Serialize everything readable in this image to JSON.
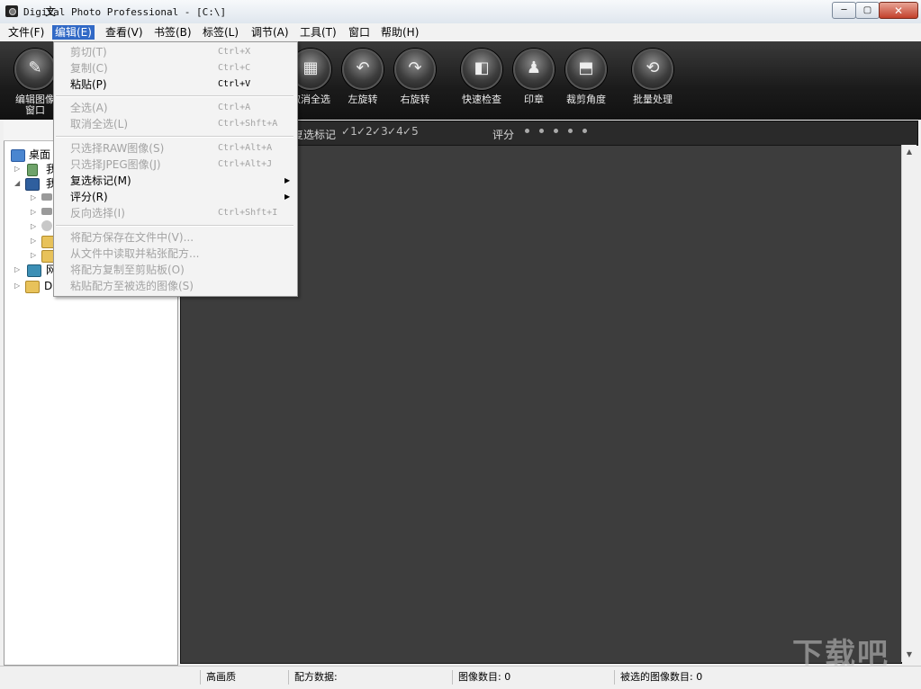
{
  "window": {
    "title": "Digital Photo Professional - [C:\\]",
    "min": "─",
    "max": "▢",
    "close": "✕"
  },
  "menubar": {
    "items": [
      "文件(F)",
      "编辑(E)",
      "查看(V)",
      "书签(B)",
      "标签(L)",
      "调节(A)",
      "工具(T)",
      "窗口",
      "帮助(H)"
    ]
  },
  "toolbar": {
    "tools": [
      {
        "label": "编辑图像窗口",
        "icon": "edit-window-icon"
      },
      {
        "label": "取消全选",
        "icon": "deselect-all-icon"
      },
      {
        "label": "左旋转",
        "icon": "rotate-left-icon"
      },
      {
        "label": "右旋转",
        "icon": "rotate-right-icon"
      },
      {
        "label": "快速检查",
        "icon": "quick-check-icon"
      },
      {
        "label": "印章",
        "icon": "stamp-icon"
      },
      {
        "label": "裁剪角度",
        "icon": "crop-angle-icon"
      },
      {
        "label": "批量处理",
        "icon": "batch-process-icon"
      }
    ]
  },
  "edit_menu": [
    {
      "label": "剪切(T)",
      "shortcut": "Ctrl+X",
      "disabled": true
    },
    {
      "label": "复制(C)",
      "shortcut": "Ctrl+C",
      "disabled": true
    },
    {
      "label": "粘贴(P)",
      "shortcut": "Ctrl+V",
      "disabled": false
    },
    {
      "label": "全选(A)",
      "shortcut": "Ctrl+A",
      "disabled": true
    },
    {
      "label": "取消全选(L)",
      "shortcut": "Ctrl+Shft+A",
      "disabled": true
    },
    {
      "label": "只选择RAW图像(S)",
      "shortcut": "Ctrl+Alt+A",
      "disabled": true
    },
    {
      "label": "只选择JPEG图像(J)",
      "shortcut": "Ctrl+Alt+J",
      "disabled": true
    },
    {
      "label": "复选标记(M)",
      "shortcut": "",
      "disabled": false,
      "submenu": true
    },
    {
      "label": "评分(R)",
      "shortcut": "",
      "disabled": false,
      "submenu": true
    },
    {
      "label": "反向选择(I)",
      "shortcut": "Ctrl+Shft+I",
      "disabled": true
    },
    {
      "label": "将配方保存在文件中(V)...",
      "shortcut": "",
      "disabled": true
    },
    {
      "label": "从文件中读取并粘张配方...",
      "shortcut": "",
      "disabled": true
    },
    {
      "label": "将配方复制至剪贴板(O)",
      "shortcut": "",
      "disabled": true
    },
    {
      "label": "粘贴配方至被选的图像(S)",
      "shortcut": "",
      "disabled": true
    }
  ],
  "left_panel": {
    "tab_label": "文",
    "tree": [
      {
        "label": "桌面",
        "icon": "desktop-icon"
      },
      {
        "label": "我",
        "icon": "documents-icon"
      },
      {
        "label": "我",
        "icon": "computer-icon"
      },
      {
        "label": "",
        "icon": "drive-icon"
      },
      {
        "label": "",
        "icon": "drive-icon"
      },
      {
        "label": "",
        "icon": "cd-drive-icon"
      },
      {
        "label": "",
        "icon": "folder-icon"
      },
      {
        "label": "",
        "icon": "folder-icon"
      },
      {
        "label": "网",
        "icon": "network-icon"
      },
      {
        "label": "Di",
        "icon": "folder-icon"
      }
    ]
  },
  "filterbar": {
    "checkmark_label": "复选标记",
    "check_numbers": [
      "1",
      "2",
      "3",
      "4",
      "5"
    ],
    "rating_label": "评分"
  },
  "statusbar": {
    "quality": "高画质",
    "recipe": "配方数据:",
    "image_count": "图像数目: 0",
    "selected_count": "被选的图像数目: 0"
  },
  "watermark": "下载吧"
}
